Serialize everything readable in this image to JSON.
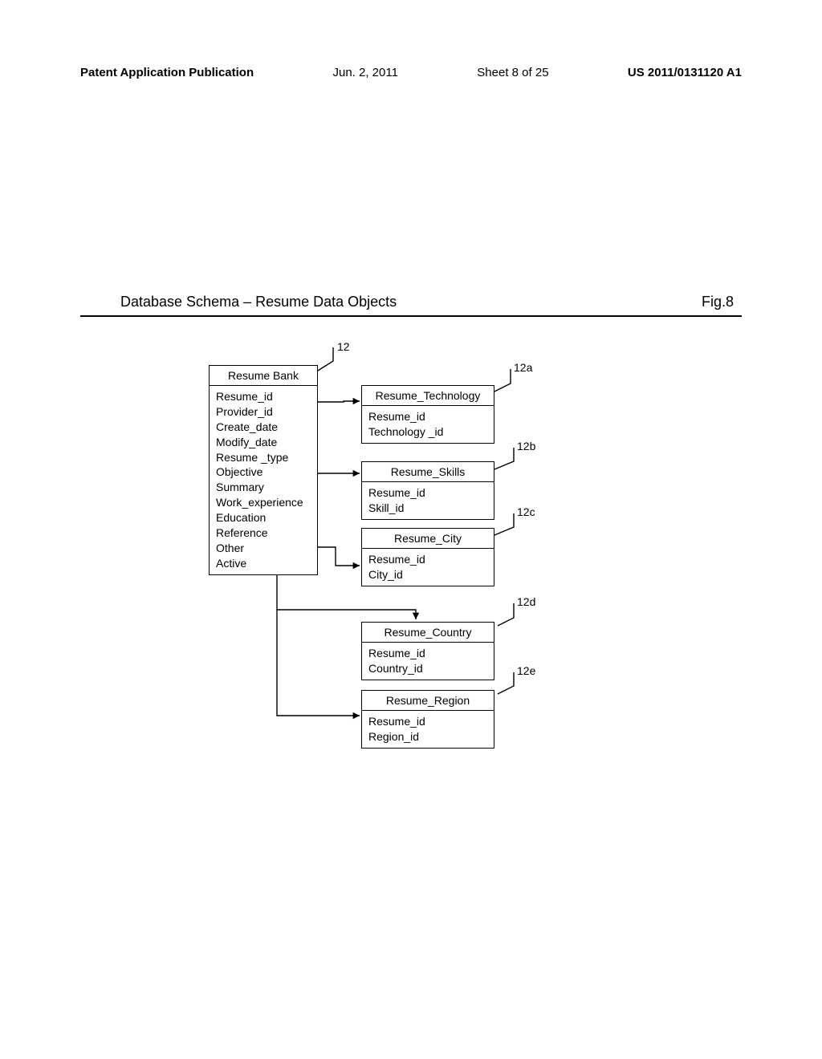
{
  "header": {
    "publication": "Patent Application Publication",
    "date": "Jun. 2, 2011",
    "sheet": "Sheet 8 of 25",
    "patent_number": "US 2011/0131120 A1"
  },
  "title_row": {
    "title": "Database Schema – Resume Data Objects",
    "figure": "Fig.8"
  },
  "labels": {
    "l12": "12",
    "l12a": "12a",
    "l12b": "12b",
    "l12c": "12c",
    "l12d": "12d",
    "l12e": "12e"
  },
  "entities": {
    "resume_bank": {
      "title": "Resume Bank",
      "fields": [
        "Resume_id",
        "Provider_id",
        "Create_date",
        "Modify_date",
        "Resume _type",
        "Objective",
        "Summary",
        "Work_experience",
        "Education",
        "Reference",
        "Other",
        "Active"
      ]
    },
    "resume_technology": {
      "title": "Resume_Technology",
      "fields": [
        "Resume_id",
        "Technology _id"
      ]
    },
    "resume_skills": {
      "title": "Resume_Skills",
      "fields": [
        "Resume_id",
        "Skill_id"
      ]
    },
    "resume_city": {
      "title": "Resume_City",
      "fields": [
        "Resume_id",
        "City_id"
      ]
    },
    "resume_country": {
      "title": "Resume_Country",
      "fields": [
        "Resume_id",
        "Country_id"
      ]
    },
    "resume_region": {
      "title": "Resume_Region",
      "fields": [
        "Resume_id",
        "Region_id"
      ]
    }
  }
}
